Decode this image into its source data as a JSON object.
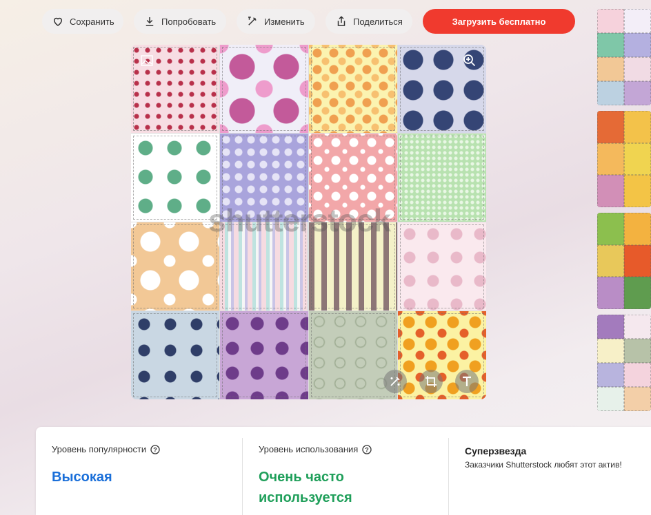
{
  "toolbar": {
    "save": "Сохранить",
    "try": "Попробовать",
    "edit": "Изменить",
    "share": "Поделиться",
    "download": "Загрузить бесплатно"
  },
  "image": {
    "watermark": "shutterstock",
    "tools": [
      "magic-wand-icon",
      "crop-icon",
      "text-icon"
    ]
  },
  "icons": {
    "top_left": "image-icon",
    "top_right": "zoom-icon"
  },
  "stats": {
    "popularity": {
      "label": "Уровень популярности",
      "value": "Высокая",
      "color": "#1a6fd9"
    },
    "usage": {
      "label": "Уровень использования",
      "value_line1": "Очень часто",
      "value_line2": "используется",
      "color": "#1f9f5a"
    },
    "superstar": {
      "title": "Суперзвезда",
      "text": "Заказчики Shutterstock любят этот актив!"
    }
  },
  "colors": {
    "cta": "#f03a2e",
    "accent_blue": "#1a6fd9",
    "accent_green": "#1f9f5a"
  }
}
